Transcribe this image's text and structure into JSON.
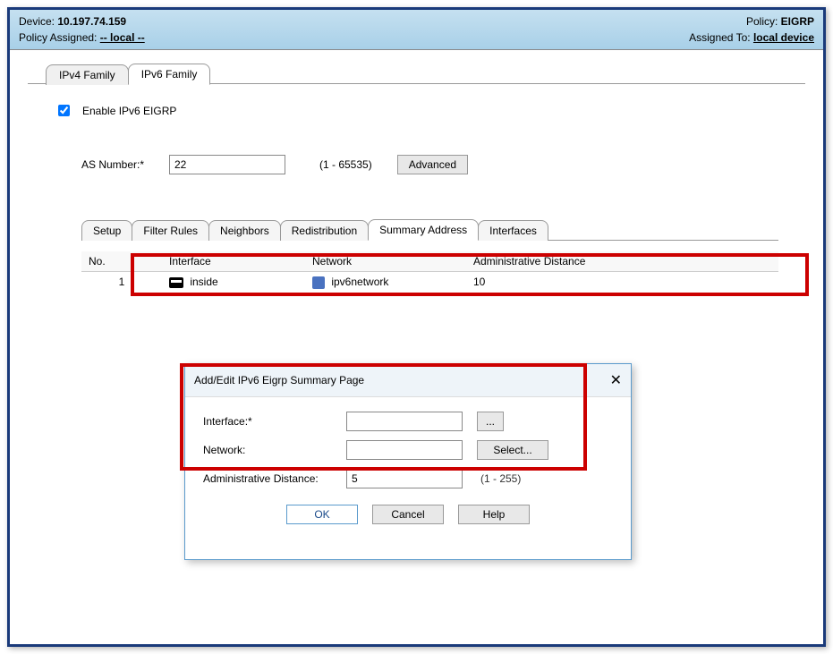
{
  "header": {
    "device_label": "Device:",
    "device_value": "10.197.74.159",
    "policy_assigned_label": "Policy Assigned:",
    "policy_assigned_value": "-- local --",
    "policy_label": "Policy:",
    "policy_value": "EIGRP",
    "assigned_to_label": "Assigned To:",
    "assigned_to_value": "local device"
  },
  "outer_tabs": {
    "ipv4": "IPv4 Family",
    "ipv6": "IPv6 Family"
  },
  "form": {
    "enable_label": "Enable IPv6 EIGRP",
    "as_label": "AS Number:*",
    "as_value": "22",
    "as_hint": "(1 - 65535)",
    "advanced_btn": "Advanced"
  },
  "subtabs": {
    "setup": "Setup",
    "filter_rules": "Filter Rules",
    "neighbors": "Neighbors",
    "redistribution": "Redistribution",
    "summary_address": "Summary Address",
    "interfaces": "Interfaces"
  },
  "table": {
    "col_no": "No.",
    "col_interface": "Interface",
    "col_network": "Network",
    "col_admin_dist": "Administrative Distance",
    "row1": {
      "no": "1",
      "interface": "inside",
      "network": "ipv6network",
      "admin_dist": "10"
    }
  },
  "dialog": {
    "title": "Add/Edit IPv6 Eigrp Summary Page",
    "interface_label": "Interface:*",
    "interface_value": "",
    "browse_btn": "...",
    "network_label": "Network:",
    "network_value": "",
    "select_btn": "Select...",
    "admin_dist_label": "Administrative Distance:",
    "admin_dist_value": "5",
    "admin_dist_hint": "(1 - 255)",
    "ok": "OK",
    "cancel": "Cancel",
    "help": "Help"
  }
}
